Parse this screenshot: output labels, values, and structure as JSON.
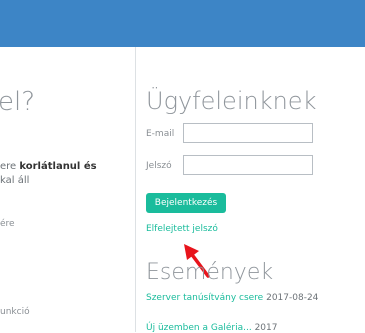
{
  "left": {
    "heading": "el?",
    "line1_prefix": "ere ",
    "line1_bold": "korlátlanul és",
    "line2": "kal áll",
    "line3": "ére",
    "line4": "unkció"
  },
  "login": {
    "heading": "Ügyfeleinknek",
    "email_label": "E-mail",
    "email_value": "",
    "password_label": "Jelszó",
    "password_value": "",
    "button_label": "Bejelentkezés",
    "forgot_link": "Elfelejtett jelszó"
  },
  "events": {
    "heading": "Események",
    "items": [
      {
        "title": "Szerver tanúsítvány csere",
        "date": "2017-08-24"
      },
      {
        "title": "Új üzemben a Galéria...",
        "date": "2017"
      }
    ]
  },
  "colors": {
    "topbar": "#3d85c6",
    "accent": "#1abc9c",
    "annotation_arrow": "#e8141c"
  },
  "icons": {
    "annotation": "red-arrow-icon"
  }
}
